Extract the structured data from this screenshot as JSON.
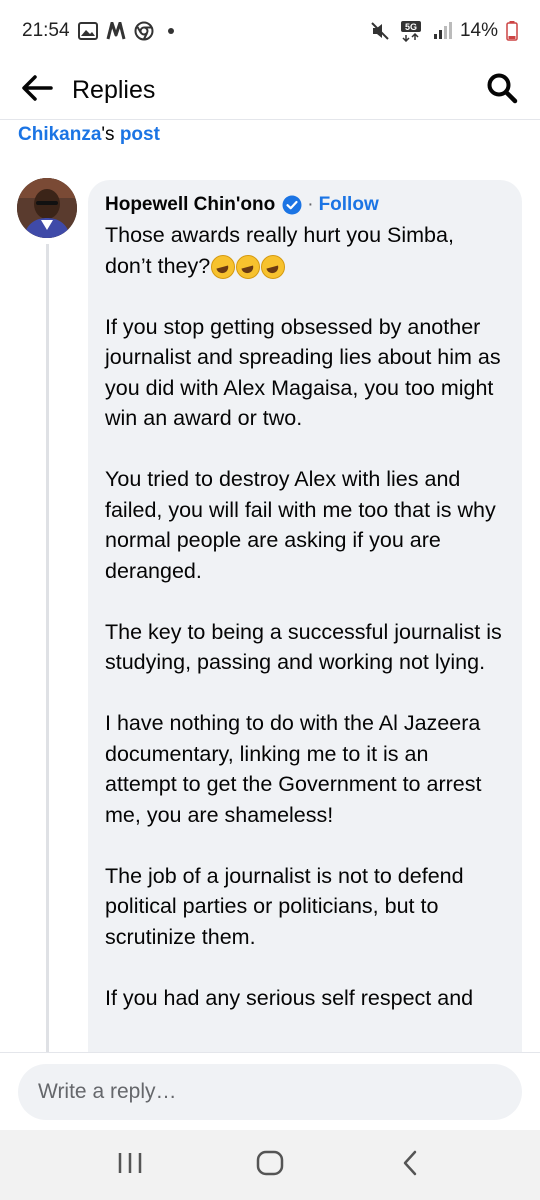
{
  "status_bar": {
    "time": "21:54",
    "network": "5G",
    "battery": "14%",
    "icons": [
      "gallery-icon",
      "nfc-n-icon",
      "chrome-icon",
      "notification-dot",
      "mute-icon",
      "signal-icon",
      "battery-icon"
    ]
  },
  "header": {
    "title": "Replies",
    "back_icon": "arrow-left-icon",
    "search_icon": "search-icon"
  },
  "source": {
    "name": "Chikanza",
    "possessive": "'s ",
    "post": "post"
  },
  "comment": {
    "author": "Hopewell Chin'ono",
    "verified": true,
    "separator": "·",
    "follow_label": "Follow",
    "paragraph_1": "Those awards really hurt you Simba, don’t they?",
    "paragraph_2": "If you stop getting obsessed by another journalist and spreading lies about him as you did with Alex Magaisa, you too might win an award or two.",
    "paragraph_3": "You tried to destroy Alex with lies and failed, you will fail with me too that is why normal people are asking if you are deranged.",
    "paragraph_4": "The key to being a successful journalist is studying, passing and working not lying.",
    "paragraph_5": "I have nothing to do with the Al Jazeera documentary, linking me to it is an attempt to get the Government to arrest me, you are shameless!",
    "paragraph_6": "The job of a journalist is not to defend political parties or politicians, but to scrutinize them.",
    "paragraph_7": "If you had any serious self respect and"
  },
  "composer": {
    "placeholder": "Write a reply…"
  },
  "nav": {
    "recents_icon": "recent-apps-icon",
    "home_icon": "home-icon",
    "back_icon": "back-chevron-icon"
  },
  "colors": {
    "link": "#1b74e4",
    "bubble": "#f0f2f5",
    "text": "#050505",
    "muted": "#65676b"
  }
}
